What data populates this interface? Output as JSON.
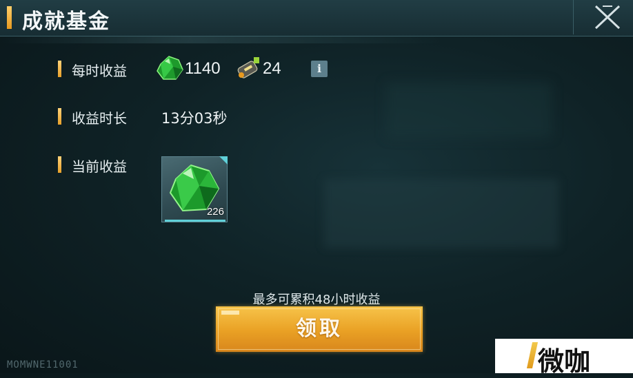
{
  "header": {
    "title": "成就基金"
  },
  "hourly": {
    "label": "每时收益",
    "gem_amount": "1140",
    "fuel_amount": "24",
    "info_label": "i"
  },
  "duration": {
    "label": "收益时长",
    "value": "13分03秒"
  },
  "current": {
    "label": "当前收益",
    "reward_count": "226"
  },
  "hint": "最多可累积48小时收益",
  "claim_button": "领取",
  "footer_code": "MOMWNE11001",
  "watermark": "微咖",
  "colors": {
    "accent": "#e9a024",
    "gem": "#2fbf3a",
    "panel": "#0f2226"
  }
}
